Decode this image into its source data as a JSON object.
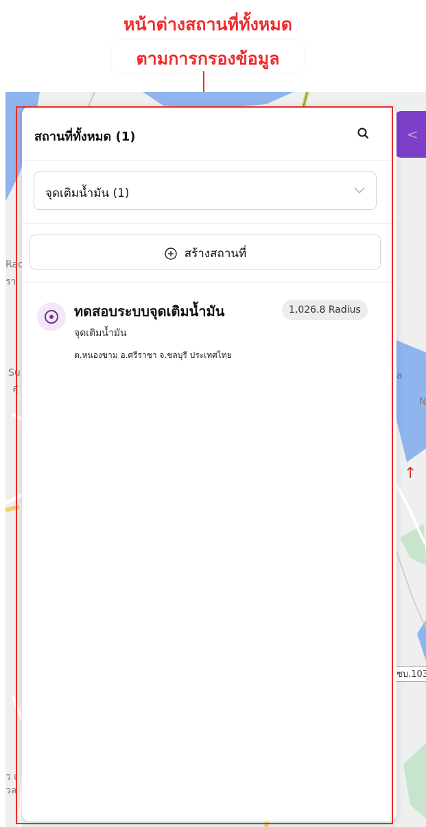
{
  "callout": {
    "line1": "หน้าต่างสถานที่ทั้งหมด",
    "line2": "ตามการกรองข้อมูล",
    "color": "#ee2b2b"
  },
  "map": {
    "labels": [
      "Rac",
      "รา",
      "Su",
      "สุ",
      "a",
      "N",
      "ว เ",
      "วล"
    ],
    "road_label": "ชบ.103",
    "arrow": "↑"
  },
  "side_tab": {
    "icon": "chevron-left-icon",
    "glyph": "<",
    "color": "#7d3fc7"
  },
  "panel": {
    "title": "สถานที่ทั้งหมด (1)",
    "search_icon": "search-icon",
    "filter": {
      "value": "จุดเติมน้ำมัน (1)",
      "icon": "chevron-down-icon"
    },
    "create_button": {
      "label": "สร้างสถานที่",
      "icon": "plus-circle-icon"
    },
    "places": [
      {
        "name": "ทดสอบระบบจุดเติมน้ำมัน",
        "radius": "1,026.8 Radius",
        "category": "จุดเติมน้ำมัน",
        "address": "ต.หนองขาม อ.ศรีราชา จ.ชลบุรี ประเทศไทย",
        "icon": "target-icon",
        "icon_color": "#7a2e8e"
      }
    ]
  }
}
